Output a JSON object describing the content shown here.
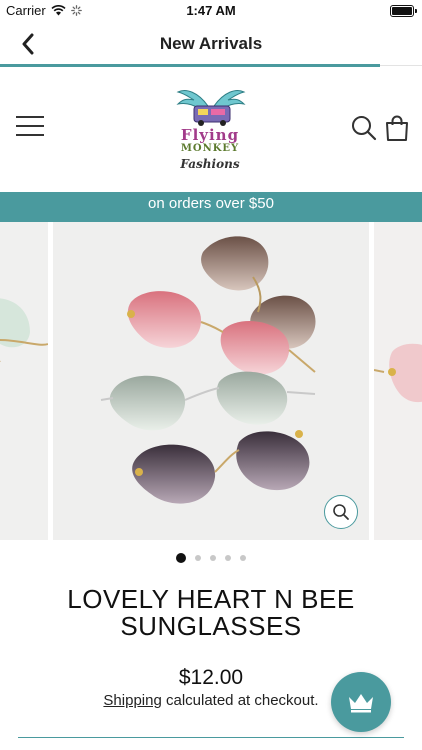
{
  "status_bar": {
    "carrier": "Carrier",
    "time": "1:47 AM"
  },
  "nav": {
    "title": "New Arrivals",
    "back_icon": "chevron-left-icon",
    "progress_fraction": 0.9
  },
  "store": {
    "logo": {
      "line1": "Flying",
      "line2": "MONKEY",
      "line3": "Fashions"
    },
    "menu_icon": "hamburger-menu-icon",
    "search_icon": "search-icon",
    "cart_icon": "shopping-bag-icon"
  },
  "promo": {
    "text": "on orders over $50"
  },
  "carousel": {
    "slide_count": 5,
    "active_index": 0,
    "zoom_icon": "zoom-icon"
  },
  "product": {
    "title": "LOVELY HEART N BEE SUNGLASSES",
    "price": "$12.00",
    "shipping_link": "Shipping",
    "shipping_rest": " calculated at checkout."
  },
  "colors": {
    "accent": "#4a9a9e"
  },
  "fab": {
    "icon": "crown-icon"
  }
}
